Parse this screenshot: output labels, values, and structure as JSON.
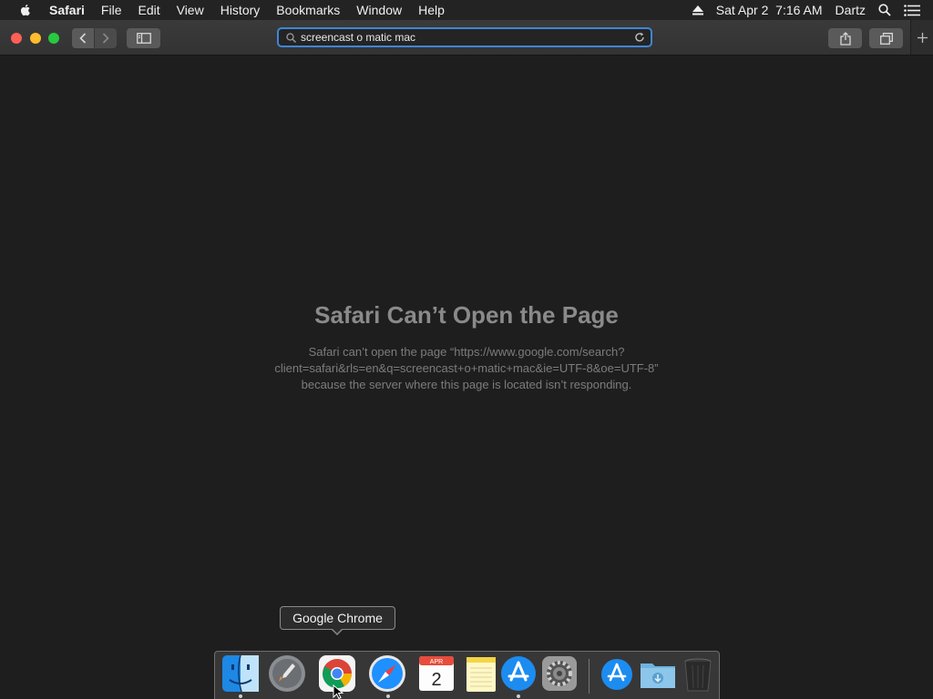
{
  "menubar": {
    "app_name": "Safari",
    "items": [
      "File",
      "Edit",
      "View",
      "History",
      "Bookmarks",
      "Window",
      "Help"
    ],
    "datetime": "Sat Apr 2  7:16 AM",
    "user": "Dartz",
    "icons": [
      "apple-icon",
      "eject-icon",
      "spotlight-search-icon",
      "notification-center-icon"
    ]
  },
  "toolbar": {
    "address_value": "screencast o matic mac",
    "buttons": [
      "back",
      "forward",
      "sidebar",
      "share",
      "tabs-overview",
      "new-tab"
    ]
  },
  "error": {
    "title": "Safari Can’t Open the Page",
    "line1": "Safari can’t open the page “https://www.google.com/search?",
    "line2": "client=safari&rls=en&q=screencast+o+matic+mac&ie=UTF-8&oe=UTF-8”",
    "line3": "because the server where this page is located isn’t responding."
  },
  "tooltip": {
    "label": "Google Chrome"
  },
  "dock": {
    "apps": [
      "Finder",
      "Launchpad",
      "Google Chrome",
      "Safari",
      "Calendar",
      "Notes",
      "App Store",
      "System Preferences",
      "Applications",
      "Downloads",
      "Trash"
    ],
    "calendar_month": "APR",
    "calendar_day": "2"
  },
  "colors": {
    "accent": "#3f86d6",
    "close": "#fe5f57",
    "minimize": "#febc2e",
    "zoom": "#28c840"
  }
}
